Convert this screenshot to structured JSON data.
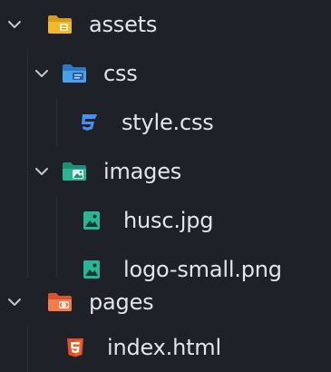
{
  "explorer": {
    "items": [
      {
        "label": "assets",
        "type": "folder",
        "expanded": true,
        "icon": "folder-assets-icon",
        "color": "#e8b12c"
      },
      {
        "label": "css",
        "type": "folder",
        "expanded": true,
        "icon": "folder-css-icon",
        "color": "#3b8edb"
      },
      {
        "label": "style.css",
        "type": "file",
        "icon": "css-file-icon",
        "color": "#3f7ee3"
      },
      {
        "label": "images",
        "type": "folder",
        "expanded": true,
        "icon": "folder-images-icon",
        "color": "#2bb594"
      },
      {
        "label": "husc.jpg",
        "type": "file",
        "icon": "image-file-icon",
        "color": "#2bb594"
      },
      {
        "label": "logo-small.png",
        "type": "file",
        "icon": "image-file-icon",
        "color": "#2bb594"
      },
      {
        "label": "pages",
        "type": "folder",
        "expanded": true,
        "icon": "folder-pages-icon",
        "color": "#f26a3a"
      },
      {
        "label": "index.html",
        "type": "file",
        "icon": "html-file-icon",
        "color": "#e44d26"
      }
    ]
  }
}
